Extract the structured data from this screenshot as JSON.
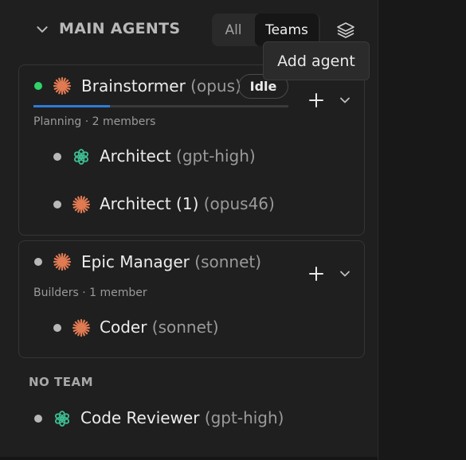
{
  "header": {
    "section_title": "MAIN AGENTS",
    "filter": {
      "all_label": "All",
      "teams_label": "Teams",
      "selected": "Teams"
    },
    "tooltip": "Add agent"
  },
  "teams": [
    {
      "lead": {
        "name": "Brainstormer",
        "model": "(opus)",
        "status": "Idle",
        "status_dot": "green",
        "icon": "claude-icon"
      },
      "subtitle": "Planning · 2 members",
      "progress": 0.3,
      "members": [
        {
          "name": "Architect",
          "model": "(gpt-high)",
          "icon": "openai-icon"
        },
        {
          "name": "Architect (1)",
          "model": "(opus46)",
          "icon": "claude-icon"
        }
      ]
    },
    {
      "lead": {
        "name": "Epic Manager",
        "model": "(sonnet)",
        "status_dot": "gray",
        "icon": "claude-icon"
      },
      "subtitle": "Builders · 1 member",
      "members": [
        {
          "name": "Coder",
          "model": "(sonnet)",
          "icon": "claude-icon"
        }
      ]
    }
  ],
  "no_team": {
    "title": "NO TEAM",
    "agents": [
      {
        "name": "Code Reviewer",
        "model": "(gpt-high)",
        "icon": "openai-icon"
      }
    ]
  },
  "colors": {
    "claude": "#e07a52",
    "openai": "#3dbd93",
    "accent": "#2f7bd6",
    "online": "#2fd36a"
  }
}
